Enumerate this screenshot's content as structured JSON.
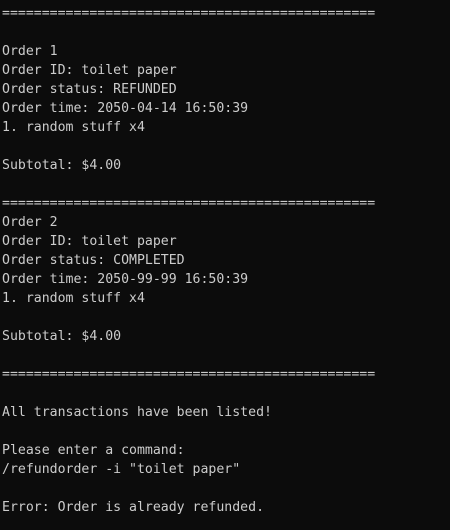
{
  "terminal": {
    "separator": "===============================================",
    "orders": [
      {
        "header": "Order 1",
        "id_line": "Order ID: toilet paper",
        "status_line": "Order status: REFUNDED",
        "time_line": "Order time: 2050-04-14 16:50:39",
        "item_line": "1. random stuff x4",
        "subtotal_line": "Subtotal: $4.00"
      },
      {
        "header": "Order 2",
        "id_line": "Order ID: toilet paper",
        "status_line": "Order status: COMPLETED",
        "time_line": "Order time: 2050-99-99 16:50:39",
        "item_line": "1. random stuff x4",
        "subtotal_line": "Subtotal: $4.00"
      }
    ],
    "listed_message": "All transactions have been listed!",
    "command_prompt": "Please enter a command:",
    "command_input": "/refundorder -i \"toilet paper\"",
    "error_message": "Error: Order is already refunded."
  },
  "colors": {
    "background": "#0c0c0c",
    "text": "#cccccc"
  }
}
